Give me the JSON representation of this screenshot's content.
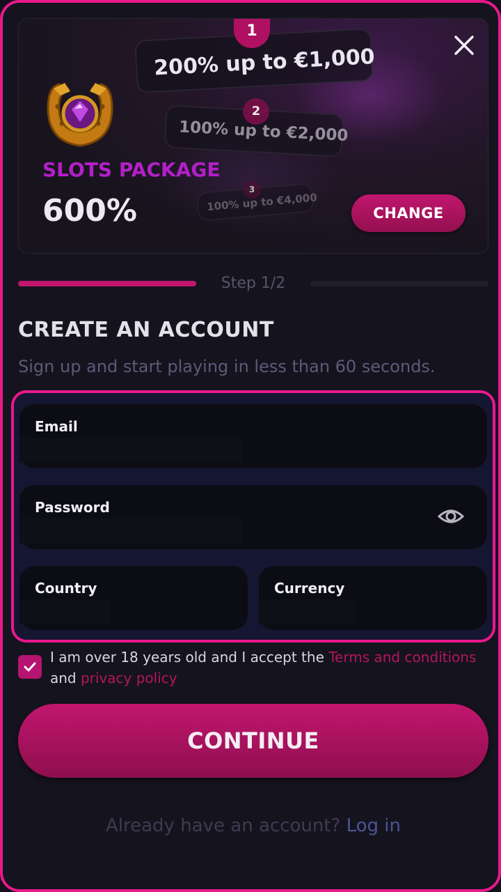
{
  "banner": {
    "tiers": [
      {
        "num": "1",
        "label": "200% up to €1,000"
      },
      {
        "num": "2",
        "label": "100% up to €2,000"
      },
      {
        "num": "3",
        "label": "100% up to €4,000"
      }
    ],
    "package_title": "SLOTS PACKAGE",
    "package_percent": "600%",
    "change_label": "CHANGE"
  },
  "step": {
    "label": "Step 1/2",
    "current": 1,
    "total": 2
  },
  "heading": "CREATE AN ACCOUNT",
  "subheading": "Sign up and start playing in less than 60 seconds.",
  "form": {
    "email_label": "Email",
    "email_value": "",
    "password_label": "Password",
    "password_value": "",
    "country_label": "Country",
    "country_value": "",
    "currency_label": "Currency",
    "currency_value": ""
  },
  "consent": {
    "checked": true,
    "text_before": "I am over 18 years old and I accept the ",
    "terms_link": "Terms and conditions",
    "text_middle": " and ",
    "privacy_link": "privacy policy"
  },
  "continue_label": "CONTINUE",
  "login": {
    "prompt": "Already have an account? ",
    "link": "Log in"
  },
  "colors": {
    "accent": "#e8198b",
    "button": "#c2166e",
    "background": "#15131e",
    "link": "#b5155f"
  }
}
